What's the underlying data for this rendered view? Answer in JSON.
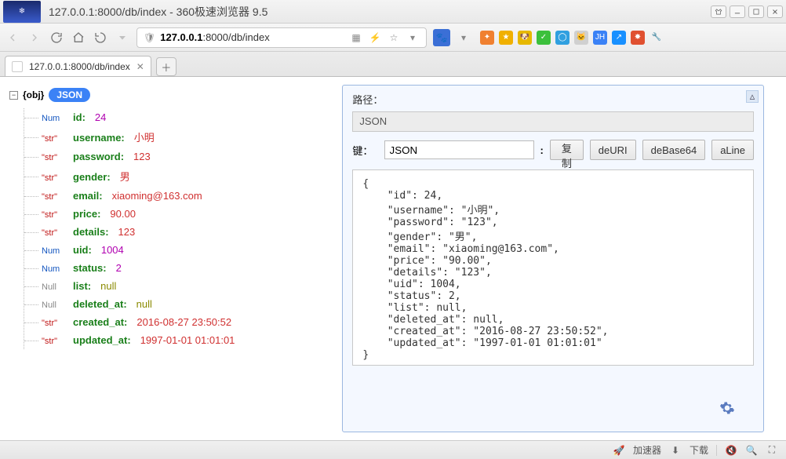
{
  "window": {
    "title": "127.0.0.1:8000/db/index - 360极速浏览器 9.5"
  },
  "nav": {
    "url_host": "127.0.0.1",
    "url_rest": ":8000/db/index"
  },
  "tab": {
    "title": "127.0.0.1:8000/db/index"
  },
  "tree": {
    "root_type": "{obj}",
    "root_badge": "JSON",
    "items": [
      {
        "type": "Num",
        "key": "id",
        "value": "24",
        "vclass": "v-num"
      },
      {
        "type": "\"str\"",
        "key": "username",
        "value": "小明",
        "vclass": "v-str"
      },
      {
        "type": "\"str\"",
        "key": "password",
        "value": "123",
        "vclass": "v-str"
      },
      {
        "type": "\"str\"",
        "key": "gender",
        "value": "男",
        "vclass": "v-str"
      },
      {
        "type": "\"str\"",
        "key": "email",
        "value": "xiaoming@163.com",
        "vclass": "v-str"
      },
      {
        "type": "\"str\"",
        "key": "price",
        "value": "90.00",
        "vclass": "v-str"
      },
      {
        "type": "\"str\"",
        "key": "details",
        "value": "123",
        "vclass": "v-str"
      },
      {
        "type": "Num",
        "key": "uid",
        "value": "1004",
        "vclass": "v-num"
      },
      {
        "type": "Num",
        "key": "status",
        "value": "2",
        "vclass": "v-num"
      },
      {
        "type": "Null",
        "key": "list",
        "value": "null",
        "vclass": "v-null"
      },
      {
        "type": "Null",
        "key": "deleted_at",
        "value": "null",
        "vclass": "v-null"
      },
      {
        "type": "\"str\"",
        "key": "created_at",
        "value": "2016-08-27 23:50:52",
        "vclass": "v-str"
      },
      {
        "type": "\"str\"",
        "key": "updated_at",
        "value": "1997-01-01 01:01:01",
        "vclass": "v-str"
      }
    ]
  },
  "panel": {
    "path_label": "路径：",
    "path_value": "JSON",
    "key_label": "键：",
    "key_value": "JSON",
    "buttons": {
      "copy": "复制",
      "deuri": "deURI",
      "debase64": "deBase64",
      "aline": "aLine"
    },
    "json_text": "{\n    \"id\": 24,\n    \"username\": \"小明\",\n    \"password\": \"123\",\n    \"gender\": \"男\",\n    \"email\": \"xiaoming@163.com\",\n    \"price\": \"90.00\",\n    \"details\": \"123\",\n    \"uid\": 1004,\n    \"status\": 2,\n    \"list\": null,\n    \"deleted_at\": null,\n    \"created_at\": \"2016-08-27 23:50:52\",\n    \"updated_at\": \"1997-01-01 01:01:01\"\n}"
  },
  "status": {
    "accel": "加速器",
    "download": "下载"
  }
}
